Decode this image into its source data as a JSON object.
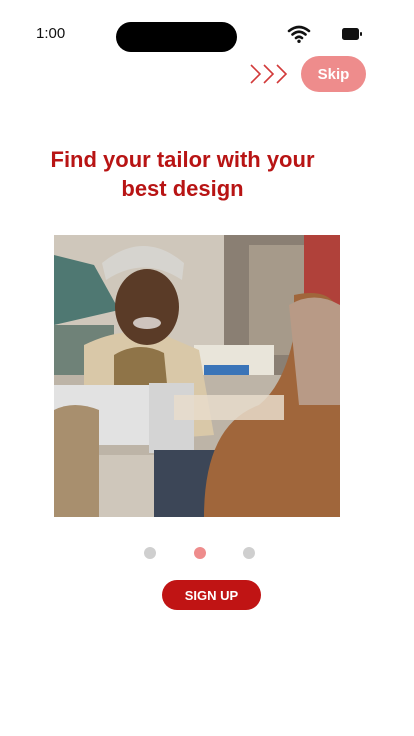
{
  "status_bar": {
    "time": "1:00"
  },
  "header": {
    "skip_label": "Skip"
  },
  "onboarding": {
    "headline": "Find your tailor with your best design",
    "image_alt": "Smiling woman in knit headband working at a sewing machine in a tailoring workshop",
    "pagination": {
      "count": 3,
      "active_index": 1
    }
  },
  "actions": {
    "signup_label": "SIGN UP"
  },
  "colors": {
    "accent": "#c01414",
    "accent_light": "#ee8c8c",
    "headline": "#b81414",
    "dot_inactive": "#cfcfcf"
  }
}
